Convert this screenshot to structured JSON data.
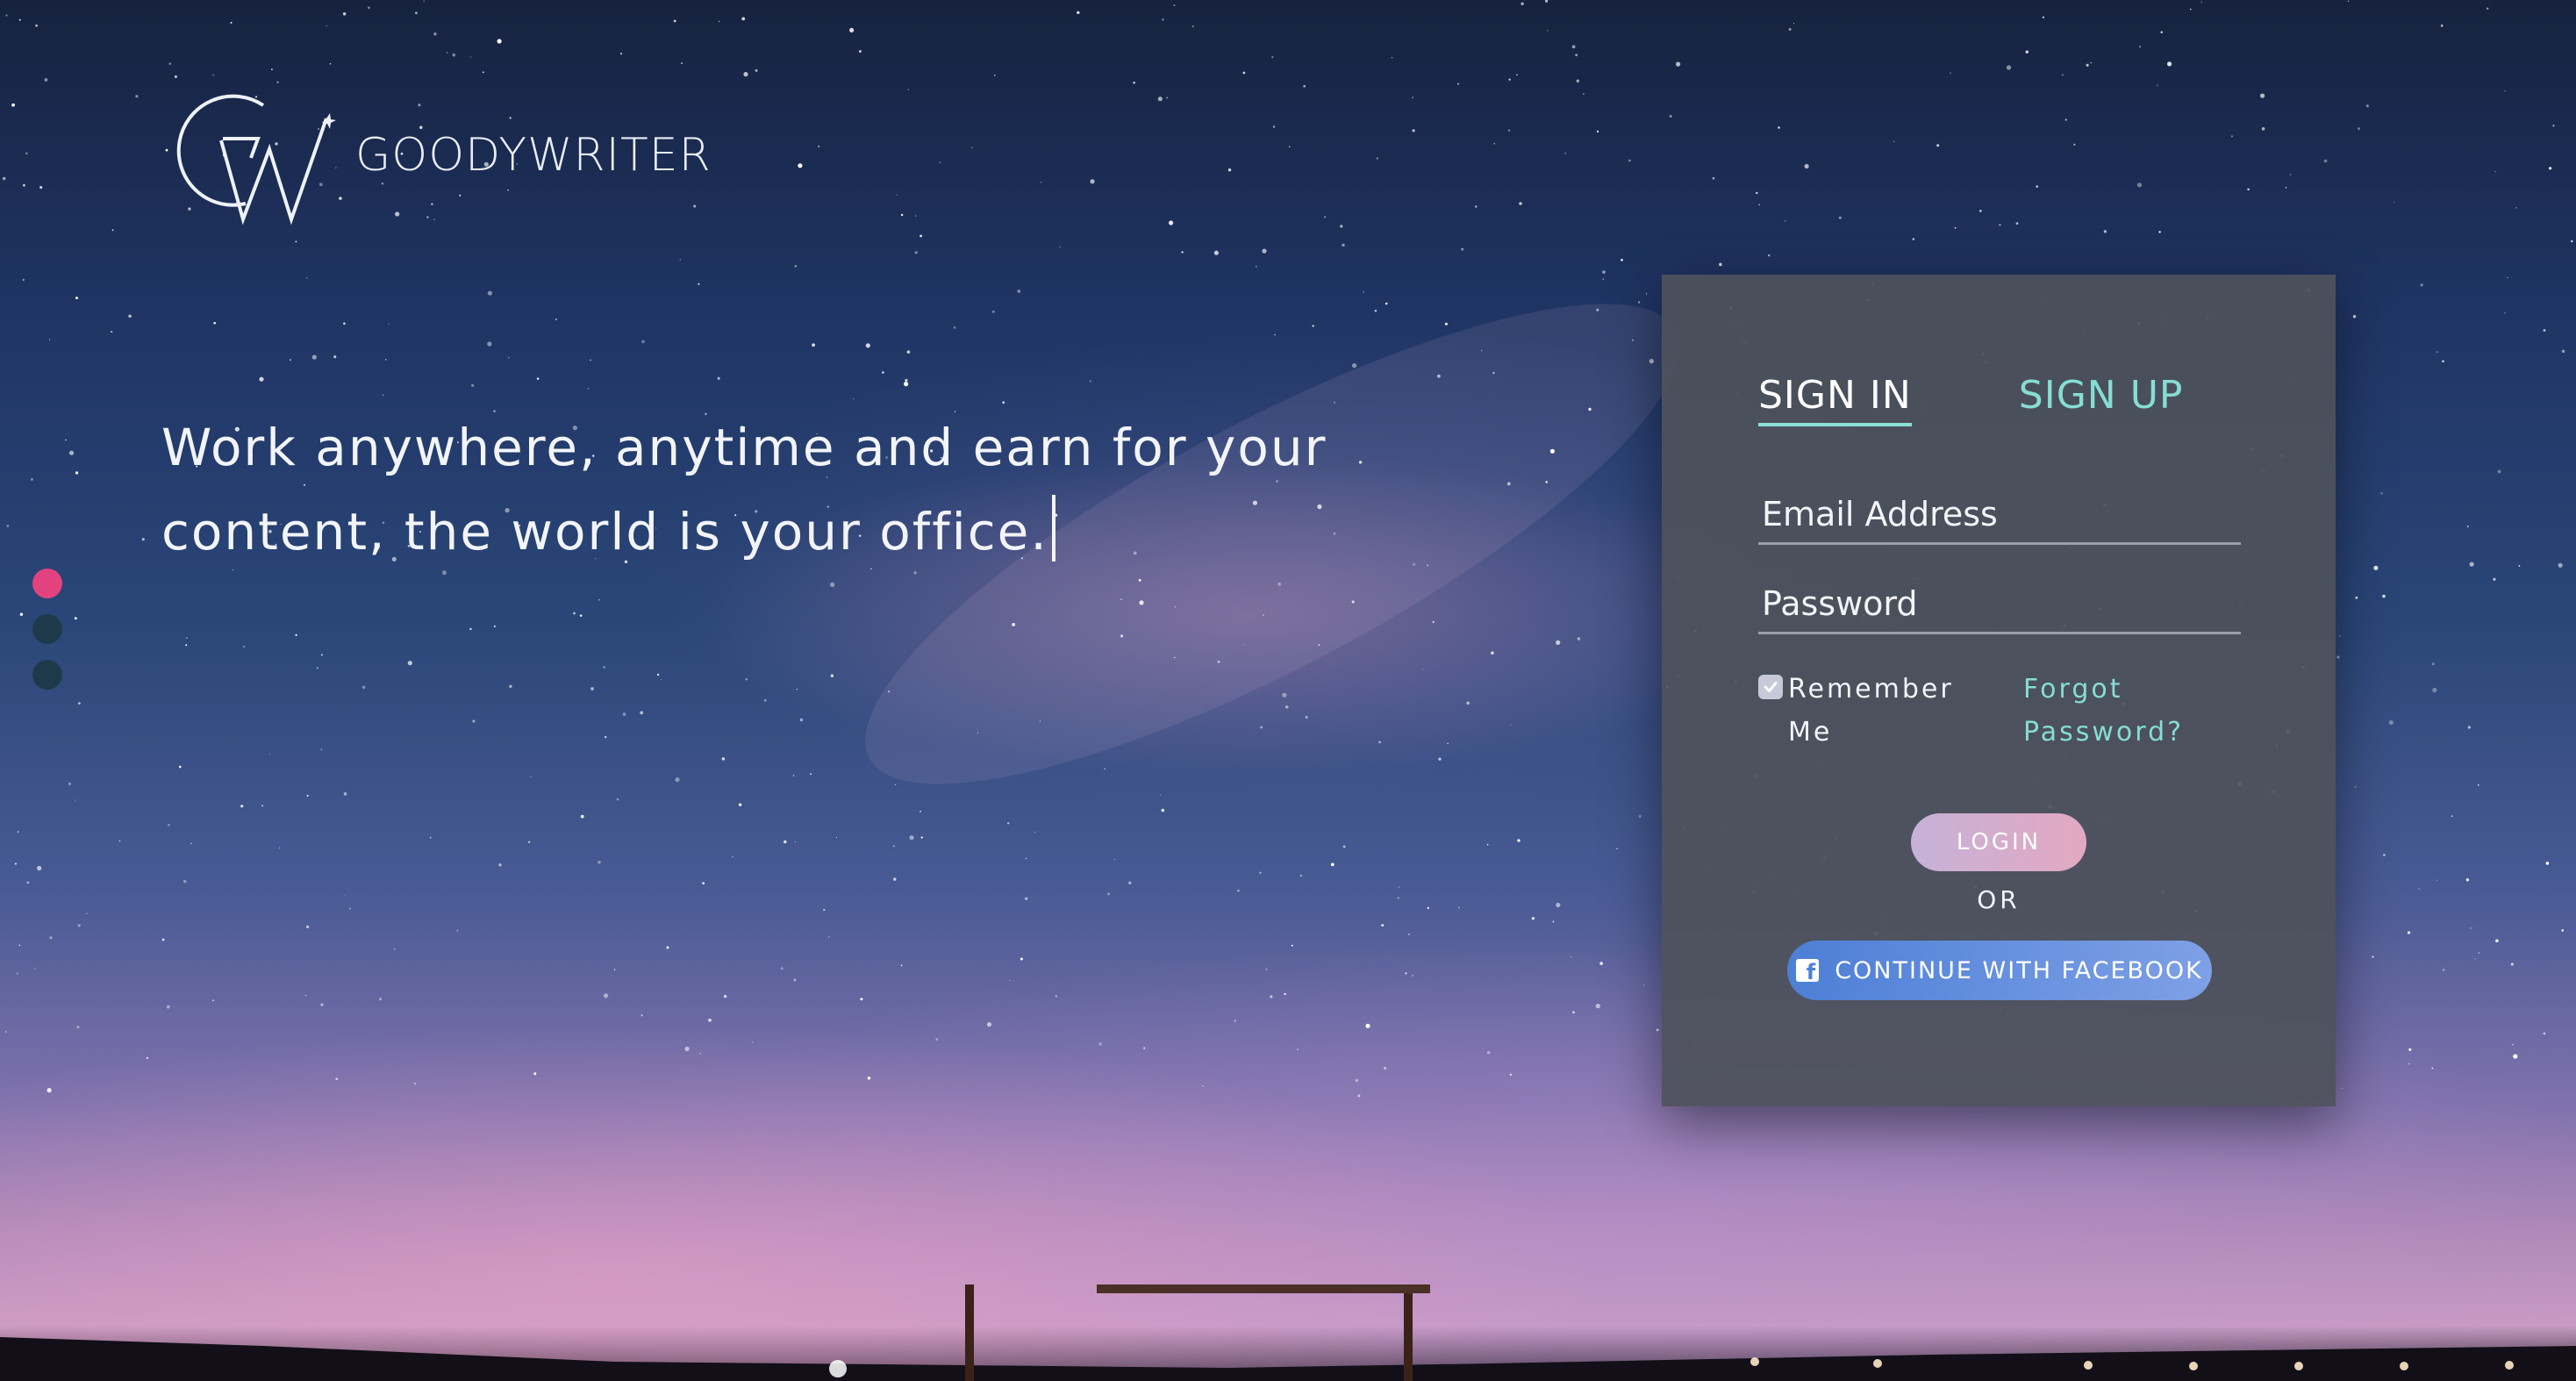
{
  "brand": {
    "name": "GOODYWRITER",
    "logo_icon": "gw-monogram-logo"
  },
  "hero": {
    "tagline": "Work anywhere, anytime and earn for your content, the world is your office."
  },
  "carousel": {
    "active_index": 0,
    "count": 3,
    "colors": {
      "active": "#e2437f",
      "inactive": "#1e3a4a"
    }
  },
  "auth": {
    "tabs": {
      "signin": "SIGN IN",
      "signup": "SIGN UP",
      "active": "signin"
    },
    "email_placeholder": "Email Address",
    "password_placeholder": "Password",
    "remember_label": "Remember Me",
    "remember_checked": true,
    "forgot_label": "Forgot Password?",
    "login_label": "LOGIN",
    "or_label": "OR",
    "facebook_label": "CONTINUE WITH FACEBOOK",
    "facebook_icon": "facebook-icon"
  },
  "colors": {
    "accent_teal": "#86ddd4",
    "card_bg": "#4e525a",
    "login_gradient": [
      "#c6b2d8",
      "#e3a8c2"
    ],
    "facebook_gradient": [
      "#4d7fd6",
      "#7ea0e6"
    ]
  }
}
